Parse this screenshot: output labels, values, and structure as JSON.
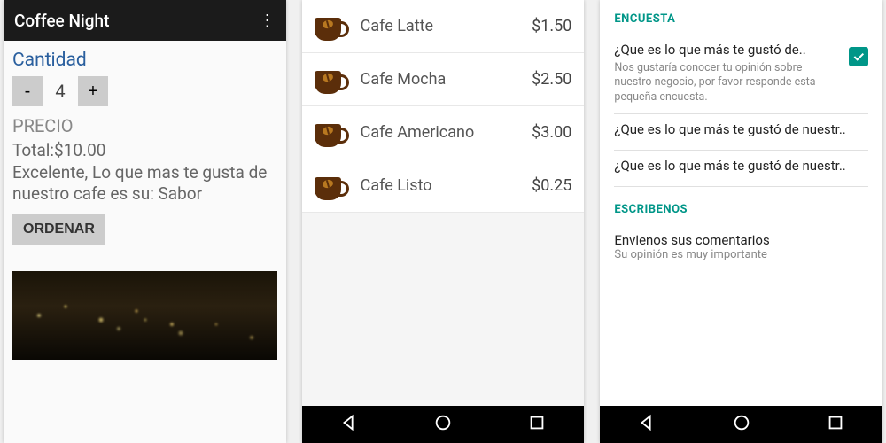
{
  "colors": {
    "teal": "#009688",
    "appbar": "#1b1b1b",
    "link": "#2a5f9e"
  },
  "phone1": {
    "title": "Coffee Night",
    "cantidad_label": "Cantidad",
    "minus": "-",
    "plus": "+",
    "qty": "4",
    "precio_label": "PRECIO",
    "summary": "Total:$10.00\n Excelente, Lo que mas te gusta de nuestro cafe es su:  Sabor",
    "order_btn": "ORDENAR"
  },
  "menu": [
    {
      "name": "Cafe Latte",
      "price": "$1.50"
    },
    {
      "name": "Cafe Mocha",
      "price": "$2.50"
    },
    {
      "name": "Cafe Americano",
      "price": "$3.00"
    },
    {
      "name": "Cafe Listo",
      "price": "$0.25"
    }
  ],
  "phone3": {
    "encuesta_header": "ENCUESTA",
    "survey": [
      {
        "title": "¿Que es lo que más te gustó de..",
        "desc": "Nos gustaría conocer tu opinión sobre nuestro negocio, por favor responde esta pequeña encuesta.",
        "checked": true
      },
      {
        "title": "¿Que es lo que más te gustó de nuestr..",
        "desc": ""
      },
      {
        "title": "¿Que es lo que más te gustó de nuestr..",
        "desc": ""
      }
    ],
    "escribenos_header": "ESCRIBENOS",
    "writeus_title": "Envienos sus comentarios",
    "writeus_desc": "Su opinión es muy importante"
  }
}
